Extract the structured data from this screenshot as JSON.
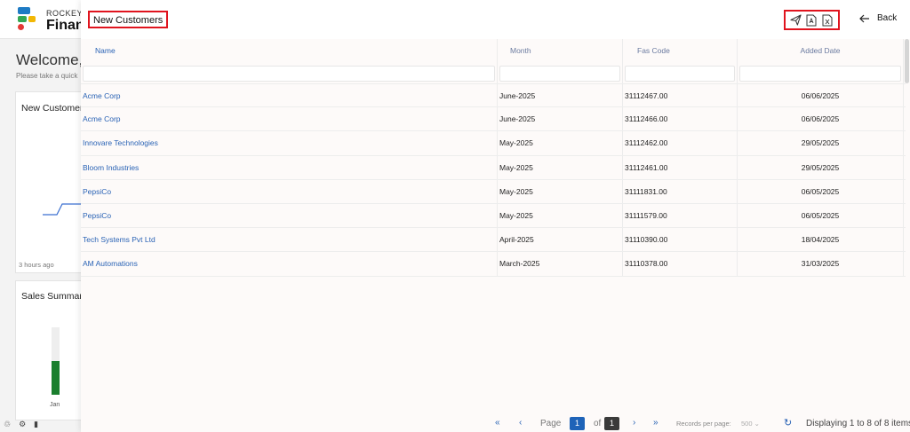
{
  "background": {
    "brand_top": "ROCKEYI",
    "brand_bottom": "Financ",
    "welcome": "Welcome, Jo",
    "subtitle": "Please take a quick",
    "card1_title": "New Customers",
    "card1_time": "3 hours ago",
    "card2_title": "Sales Summary",
    "card2_bar_label": "Jan",
    "card2_bar_fraction": 0.5
  },
  "panel": {
    "title": "New Customers",
    "back_label": "Back",
    "actions": [
      "send-icon",
      "pdf-icon",
      "excel-icon"
    ]
  },
  "table": {
    "columns": [
      "Name",
      "Month",
      "Fas Code",
      "Added Date"
    ],
    "rows": [
      {
        "name": "Acme Corp",
        "month": "June-2025",
        "fas": "31112467.00",
        "date": "06/06/2025"
      },
      {
        "name": "Acme Corp",
        "month": "June-2025",
        "fas": "31112466.00",
        "date": "06/06/2025"
      },
      {
        "name": "Innovare Technologies",
        "month": "May-2025",
        "fas": "31112462.00",
        "date": "29/05/2025"
      },
      {
        "name": "Bloom Industries",
        "month": "May-2025",
        "fas": "31112461.00",
        "date": "29/05/2025"
      },
      {
        "name": "PepsiCo",
        "month": "May-2025",
        "fas": "31111831.00",
        "date": "06/05/2025"
      },
      {
        "name": "PepsiCo",
        "month": "May-2025",
        "fas": "31111579.00",
        "date": "06/05/2025"
      },
      {
        "name": "Tech Systems Pvt Ltd",
        "month": "April-2025",
        "fas": "31110390.00",
        "date": "18/04/2025"
      },
      {
        "name": "AM Automations",
        "month": "March-2025",
        "fas": "31110378.00",
        "date": "31/03/2025"
      }
    ]
  },
  "pager": {
    "page_label": "Page",
    "current_page": "1",
    "of_label": "of",
    "total_pages": "1",
    "records_label": "Records per page:",
    "records_value": "500",
    "display_text": "Displaying 1 to 8 of 8 items."
  },
  "colors": {
    "accent": "#2a63b5",
    "highlight_border": "#e0141e",
    "page_box_active": "#1e63b8",
    "page_box_total": "#3a3a3a"
  }
}
